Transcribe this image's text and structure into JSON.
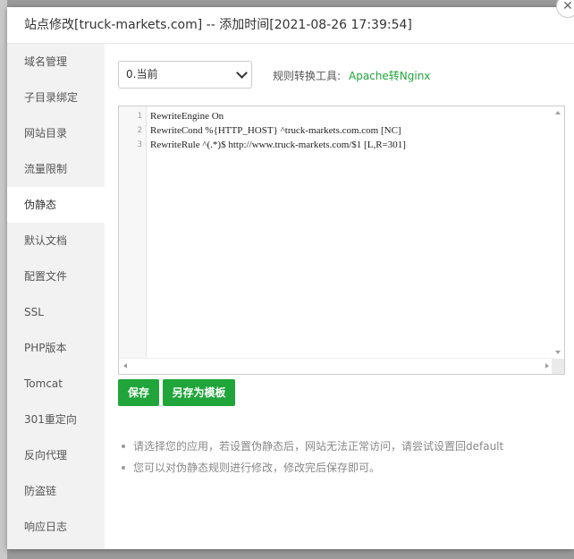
{
  "dialog": {
    "title": "站点修改[truck-markets.com] -- 添加时间[2021-08-26 17:39:54]",
    "close_glyph": "✕"
  },
  "sidebar": {
    "items": [
      {
        "label": "域名管理",
        "active": false
      },
      {
        "label": "子目录绑定",
        "active": false
      },
      {
        "label": "网站目录",
        "active": false
      },
      {
        "label": "流量限制",
        "active": false
      },
      {
        "label": "伪静态",
        "active": true
      },
      {
        "label": "默认文档",
        "active": false
      },
      {
        "label": "配置文件",
        "active": false
      },
      {
        "label": "SSL",
        "active": false
      },
      {
        "label": "PHP版本",
        "active": false
      },
      {
        "label": "Tomcat",
        "active": false
      },
      {
        "label": "301重定向",
        "active": false
      },
      {
        "label": "反向代理",
        "active": false
      },
      {
        "label": "防盗链",
        "active": false
      },
      {
        "label": "响应日志",
        "active": false
      }
    ]
  },
  "rewrite": {
    "selected_version": "0.当前",
    "tool_label": "规则转换工具:",
    "tool_link": "Apache转Nginx",
    "editor": {
      "lines": [
        {
          "num": "1",
          "text": "RewriteEngine On"
        },
        {
          "num": "2",
          "text": "RewriteCond %{HTTP_HOST} ^truck-markets.com.com [NC]"
        },
        {
          "num": "3",
          "text": "RewriteRule ^(.*)$ http://www.truck-markets.com/$1 [L,R=301]"
        }
      ]
    },
    "save_label": "保存",
    "save_template_label": "另存为模板",
    "tips": [
      "请选择您的应用，若设置伪静态后，网站无法正常访问，请尝试设置回default",
      "您可以对伪静态规则进行修改，修改完后保存即可。"
    ]
  },
  "colors": {
    "accent": "#20a53a",
    "sidebar_bg": "#f2f2f2",
    "backdrop": "#9a9a9a"
  }
}
